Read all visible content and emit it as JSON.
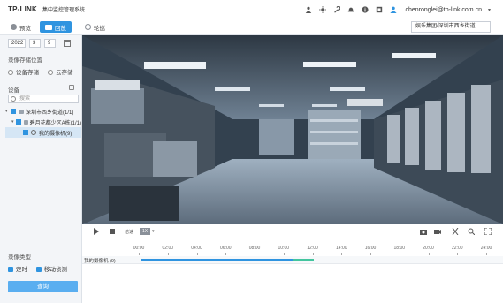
{
  "topbar": {
    "logo": "TP-LINK",
    "app_title": "集中监控管理系统",
    "user_email": "chenronglei@tp-link.com.cn",
    "icons": [
      "user-icon",
      "sun-icon",
      "wrench-icon",
      "bell-icon",
      "info-icon",
      "download-icon"
    ]
  },
  "tabs": {
    "preview": "预览",
    "playback": "回放",
    "tour": "轮巡",
    "group_select": "娱乐集团/深圳市西乡街道"
  },
  "sidebar": {
    "year": "2022",
    "month": "3",
    "day": "9",
    "storage_title": "录像存储位置",
    "storage_device": "设备存储",
    "storage_cloud": "云存储",
    "device_title": "设备",
    "search_placeholder": "搜索",
    "tree": [
      {
        "label": "深圳市西乡街道(1/1)"
      },
      {
        "label": "碧月花都少区A栋(1/1)"
      },
      {
        "label": "我的摄像机(9)"
      }
    ],
    "record_type_title": "录像类型",
    "record_timed": "定时",
    "record_motion": "移动侦测",
    "query_button": "查询"
  },
  "controls": {
    "speed_label": "1X",
    "speed_caption": "倍速",
    "icons": [
      "play-icon",
      "stop-icon",
      "camera-icon",
      "record-icon",
      "cut-icon",
      "zoom-icon",
      "fullscreen-icon"
    ]
  },
  "timeline": {
    "ticks": [
      "00:00",
      "02:00",
      "04:00",
      "06:00",
      "08:00",
      "10:00",
      "12:00",
      "14:00",
      "16:00",
      "18:00",
      "20:00",
      "22:00",
      "24:00"
    ],
    "track_label": "我的摄像机 (9)",
    "segments": [
      {
        "type": "timed",
        "start_hour": 0.2,
        "end_hour": 10.6
      },
      {
        "type": "motion",
        "start_hour": 10.6,
        "end_hour": 12.1
      }
    ],
    "colors": {
      "timed": "#2f94e0",
      "motion": "#43c59e"
    }
  }
}
